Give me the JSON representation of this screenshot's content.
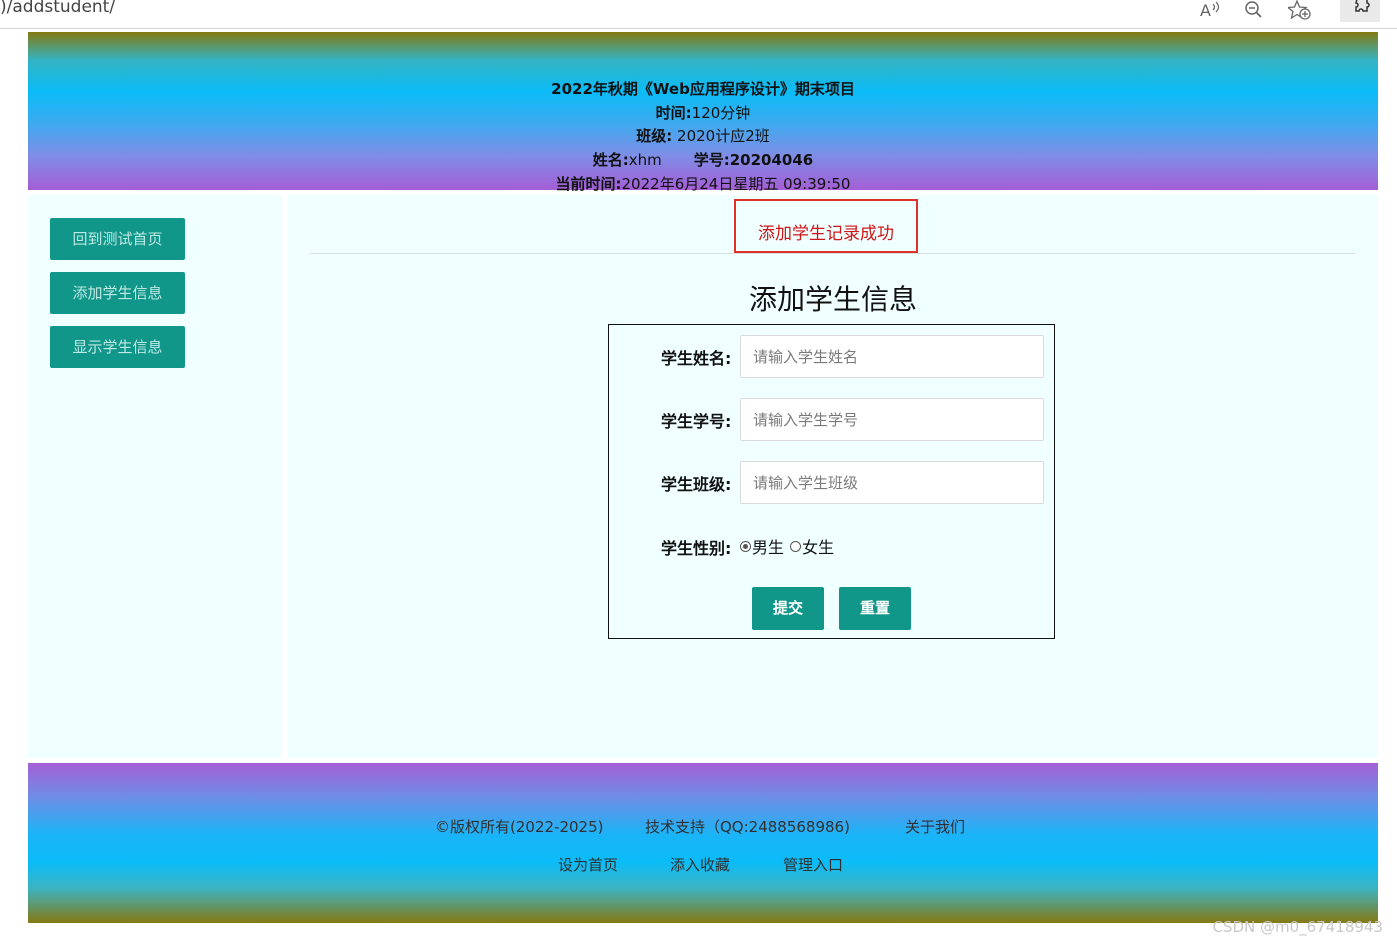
{
  "browser": {
    "url": ")/addstudent/",
    "icons": [
      "read-aloud-icon",
      "zoom-out-icon",
      "add-favorite-icon",
      "extensions-icon"
    ]
  },
  "header": {
    "title": "2022年秋期《Web应用程序设计》期末项目",
    "time_label": "时间:",
    "time_value": "120分钟",
    "class_label": "班级:",
    "class_value": "2020计应2班",
    "name_label": "姓名:",
    "name_value": "xhm",
    "id_label": "学号:",
    "id_value": "20204046",
    "now_label": "当前时间:",
    "now_value": "2022年6月24日星期五 09:39:50"
  },
  "sidebar": {
    "items": [
      {
        "label": "回到测试首页"
      },
      {
        "label": "添加学生信息"
      },
      {
        "label": "显示学生信息"
      }
    ]
  },
  "main": {
    "success_message": "添加学生记录成功",
    "form_title": "添加学生信息",
    "fields": [
      {
        "label": "学生姓名:",
        "placeholder": "请输入学生姓名",
        "value": ""
      },
      {
        "label": "学生学号:",
        "placeholder": "请输入学生学号",
        "value": ""
      },
      {
        "label": "学生班级:",
        "placeholder": "请输入学生班级",
        "value": ""
      }
    ],
    "gender_label": "学生性别:",
    "gender_options": [
      {
        "label": "男生",
        "checked": true
      },
      {
        "label": "女生",
        "checked": false
      }
    ],
    "submit_label": "提交",
    "reset_label": "重置"
  },
  "footer": {
    "row1": [
      "©版权所有(2022-2025)",
      "技术支持（QQ:2488568986)",
      "关于我们"
    ],
    "row2": [
      "设为首页",
      "添入收藏",
      "管理入口"
    ]
  },
  "watermark": "CSDN @m0_67418943",
  "colors": {
    "accent": "#11968a",
    "panel_bg": "#f0ffff",
    "alert_border": "#e0302a",
    "alert_text": "#d01616"
  }
}
